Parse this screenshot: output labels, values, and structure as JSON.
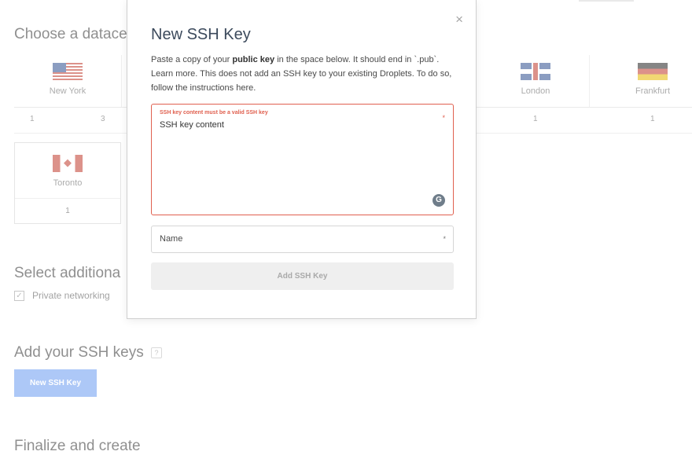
{
  "background": {
    "datacenter_title": "Choose a datace",
    "datacenters": [
      {
        "name": "New York",
        "count": "1",
        "count_alt": "3"
      },
      {
        "name": "London",
        "count": "1"
      },
      {
        "name": "Frankfurt",
        "count": "1"
      },
      {
        "name": "Toronto",
        "count": "1"
      }
    ],
    "additional_title": "Select additiona",
    "private_networking_label": "Private networking",
    "ssh_title": "Add your SSH keys",
    "ssh_help": "?",
    "new_ssh_button": "New SSH Key",
    "finalize_title": "Finalize and create"
  },
  "modal": {
    "title": "New SSH Key",
    "close_icon": "×",
    "desc_part1": "Paste a copy of your ",
    "desc_bold": "public key",
    "desc_part2": " in the space below. It should end in `.pub`. ",
    "learn_more": "Learn more.",
    "desc_part3": " This does not add an SSH key to your existing Droplets. To do so, ",
    "instructions_link": "follow the instructions here.",
    "key_error": "SSH key content must be a valid SSH key",
    "key_placeholder": "SSH key content",
    "required_mark": "*",
    "grammarly_icon": "G",
    "name_label": "Name",
    "add_button": "Add SSH Key"
  },
  "colors": {
    "error": "#e0604f",
    "accent": "#6a9cf0"
  }
}
